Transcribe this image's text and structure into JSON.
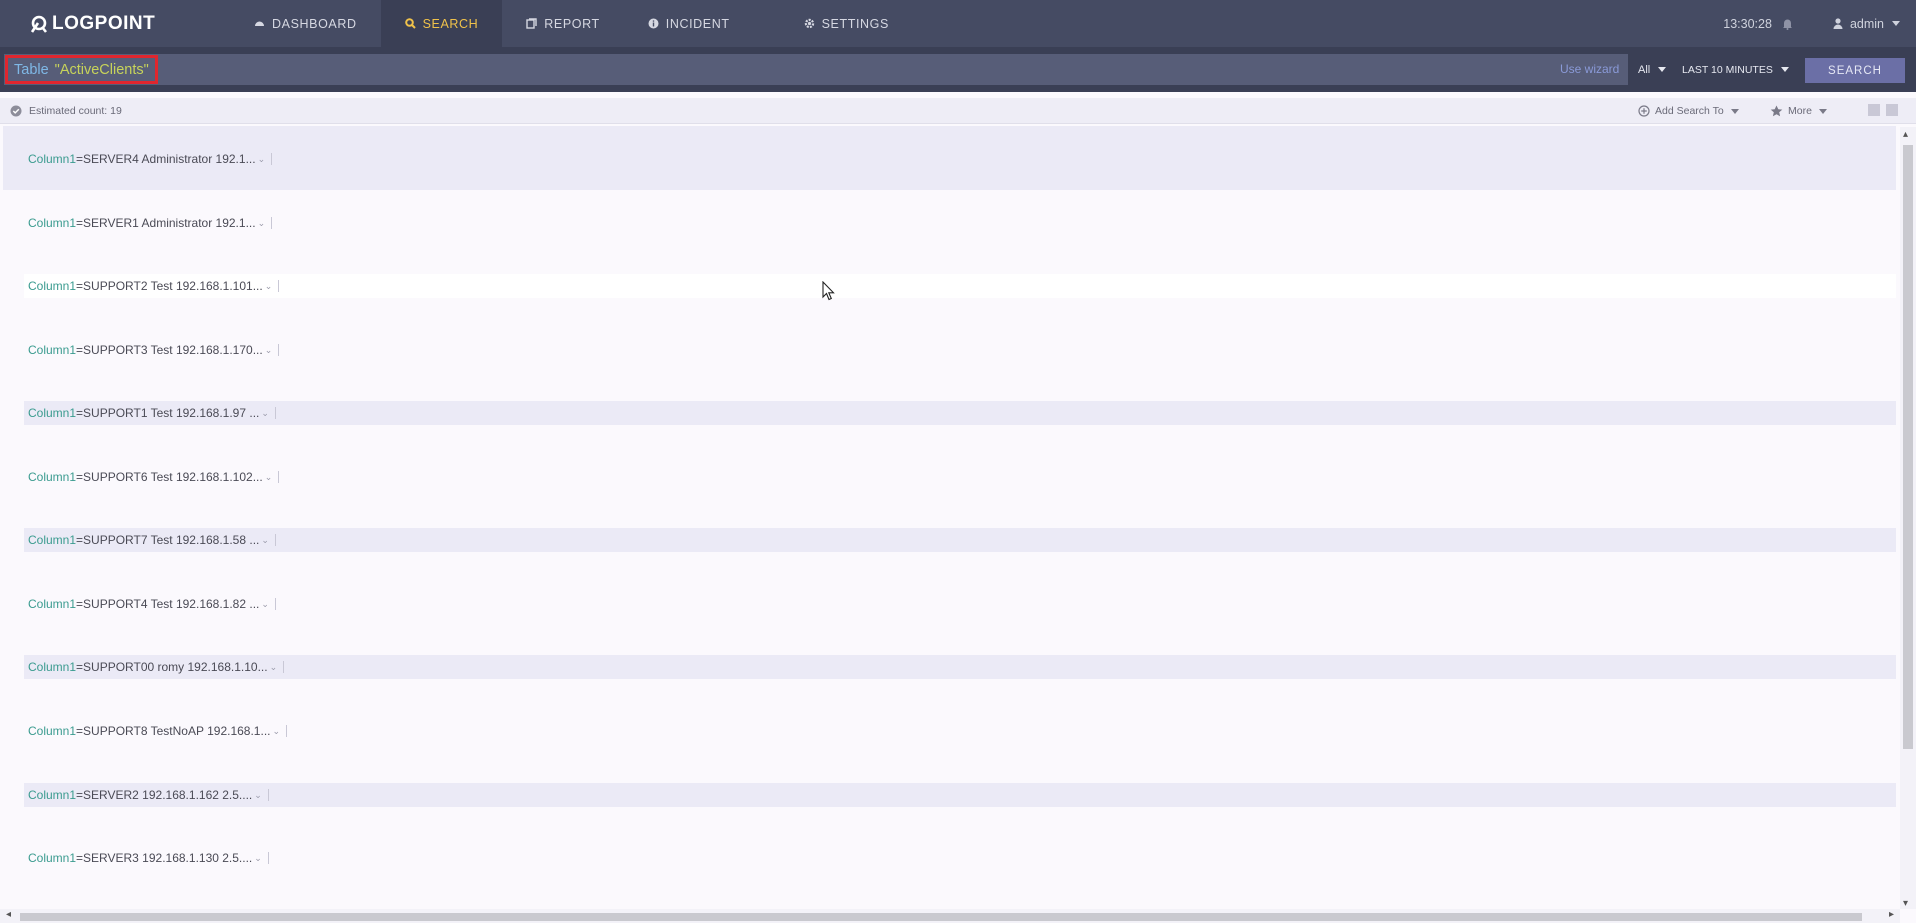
{
  "nav": {
    "logo": "LOGPOINT",
    "items": [
      {
        "label": "DASHBOARD",
        "icon": "dashboard-icon",
        "active": false
      },
      {
        "label": "SEARCH",
        "icon": "search-icon",
        "active": true
      },
      {
        "label": "REPORT",
        "icon": "report-icon",
        "active": false
      },
      {
        "label": "INCIDENT",
        "icon": "info-icon",
        "active": false
      },
      {
        "label": "SETTINGS",
        "icon": "gear-icon",
        "active": false
      }
    ],
    "clock": "13:30:28",
    "user": "admin"
  },
  "search": {
    "query_keyword": "Table",
    "query_string": "\"ActiveClients\"",
    "use_wizard": "Use wizard",
    "scope": "All",
    "time_range": "LAST 10 MINUTES",
    "button": "SEARCH"
  },
  "info": {
    "estimated_count": "Estimated count: 19",
    "add_search_to": "Add Search To",
    "more": "More"
  },
  "results": [
    {
      "key": "Column1",
      "value": "=SERVER4 Administrator 192.1..."
    },
    {
      "key": "Column1",
      "value": "=SERVER1 Administrator 192.1..."
    },
    {
      "key": "Column1",
      "value": "=SUPPORT2 Test 192.168.1.101..."
    },
    {
      "key": "Column1",
      "value": "=SUPPORT3 Test 192.168.1.170..."
    },
    {
      "key": "Column1",
      "value": "=SUPPORT1 Test 192.168.1.97 ..."
    },
    {
      "key": "Column1",
      "value": "=SUPPORT6 Test 192.168.1.102..."
    },
    {
      "key": "Column1",
      "value": "=SUPPORT7 Test 192.168.1.58 ..."
    },
    {
      "key": "Column1",
      "value": "=SUPPORT4 Test 192.168.1.82 ..."
    },
    {
      "key": "Column1",
      "value": "=SUPPORT00 romy 192.168.1.10..."
    },
    {
      "key": "Column1",
      "value": "=SUPPORT8 TestNoAP 192.168.1..."
    },
    {
      "key": "Column1",
      "value": "=SERVER2 192.168.1.162 2.5...."
    },
    {
      "key": "Column1",
      "value": "=SERVER3 192.168.1.130 2.5...."
    }
  ]
}
